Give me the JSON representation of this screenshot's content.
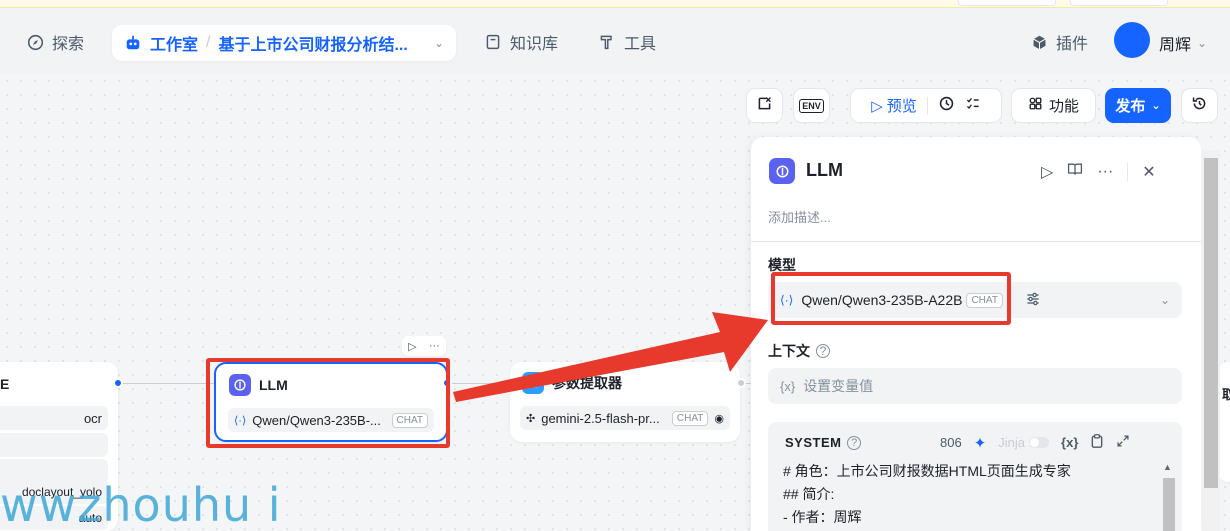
{
  "header": {
    "explore": "探索",
    "studio": "工作室",
    "separator": "/",
    "project_title": "基于上市公司财报分析结...",
    "knowledge": "知识库",
    "tools": "工具",
    "plugins": "插件",
    "user_name": "周辉"
  },
  "toolbar": {
    "preview": "预览",
    "features": "功能",
    "publish": "发布",
    "env_label": "ENV"
  },
  "left_node": {
    "title_fragment": "E",
    "rows": [
      "ocr",
      "",
      "",
      "doclayout_yolo",
      "auto"
    ]
  },
  "llm_node": {
    "title": "LLM",
    "model": "Qwen/Qwen3-235B-...",
    "tag": "CHAT"
  },
  "param_node": {
    "title": "参数提取器",
    "model": "gemini-2.5-flash-pr...",
    "tag": "CHAT"
  },
  "panel": {
    "title": "LLM",
    "description_placeholder": "添加描述...",
    "model_label": "模型",
    "model_value": "Qwen/Qwen3-235B-A22B",
    "model_tag": "CHAT",
    "context_label": "上下文",
    "context_placeholder": "设置变量值",
    "var_icon": "{x}",
    "system_label": "SYSTEM",
    "system_count": "806",
    "jinja_label": "Jinja",
    "system_lines": [
      "# 角色：上市公司财报数据HTML页面生成专家",
      "## 简介:",
      "- 作者：周辉"
    ]
  },
  "edge_node": {
    "fragment": "取"
  },
  "watermark": "wwzhouhu i",
  "colors": {
    "accent": "#1664ff",
    "highlight": "#e8392d",
    "node_icon": "#5b62f0"
  }
}
